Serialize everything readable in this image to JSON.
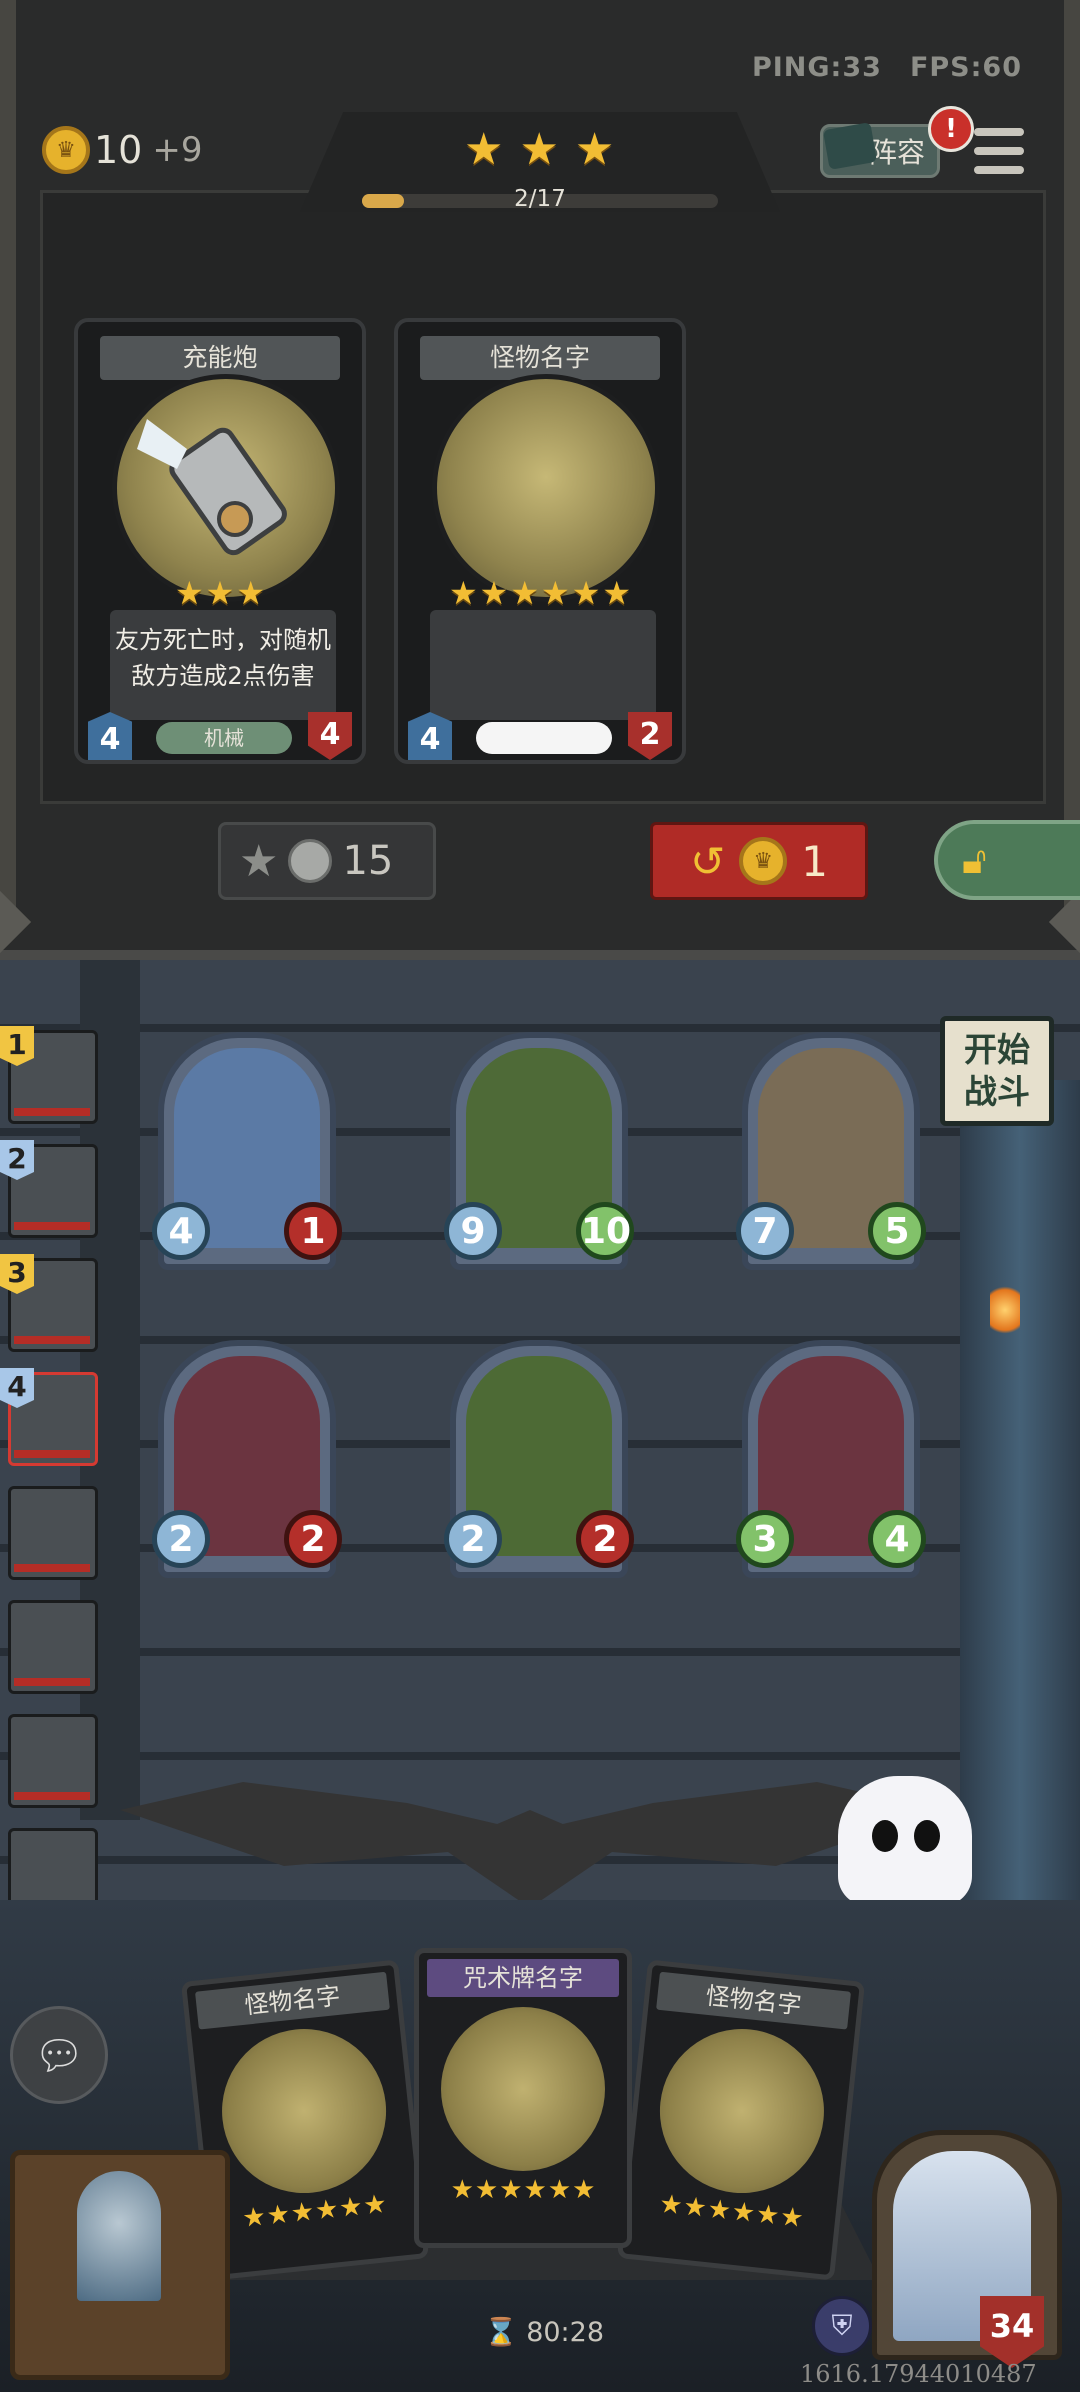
{
  "hud": {
    "ping_label": "PING:33",
    "fps_label": "FPS:60"
  },
  "gold": {
    "value": "10",
    "income": "+9",
    "coin_icon": "crown-coin-icon"
  },
  "tavern": {
    "tier_stars": 3,
    "xp_current": 2,
    "xp_max": 17,
    "xp_text": "2/17"
  },
  "lineup_button": {
    "label": "阵容",
    "alert": "!"
  },
  "shop_cards": [
    {
      "title": "充能炮",
      "stars": 3,
      "description": "友方死亡时，对随机敌方造成2点伤害",
      "tag": "机械",
      "attack": "4",
      "health": "4"
    },
    {
      "title": "怪物名字",
      "stars": 6,
      "description": "",
      "tag": "",
      "attack": "4",
      "health": "2"
    }
  ],
  "upgrade": {
    "cost": "15"
  },
  "refresh": {
    "cost": "1"
  },
  "start_battle": {
    "label_line1": "开始",
    "label_line2": "战斗"
  },
  "team_list": [
    {
      "num": "1",
      "hp_fraction": 0.8
    },
    {
      "num": "2",
      "hp_fraction": 0.8
    },
    {
      "num": "3",
      "hp_fraction": 0.8
    },
    {
      "num": "4",
      "hp_fraction": 0.8,
      "selected": true
    },
    {
      "num": "",
      "hp_fraction": 0.8
    },
    {
      "num": "",
      "hp_fraction": 0.8
    },
    {
      "num": "",
      "hp_fraction": 0.8
    },
    {
      "num": "",
      "hp_fraction": 0.8
    }
  ],
  "board_minions": [
    {
      "attack": "4",
      "health": "1",
      "art_color": "#5b7aa5"
    },
    {
      "attack": "9",
      "health": "10",
      "art_color": "#4e6a37"
    },
    {
      "attack": "7",
      "health": "5",
      "art_color": "#7a6c56"
    },
    {
      "attack": "2",
      "health": "2",
      "art_color": "#6b3440"
    },
    {
      "attack": "2",
      "health": "2",
      "art_color": "#4d6a35"
    },
    {
      "attack": "3",
      "health": "4",
      "art_color": "#6b3440"
    }
  ],
  "hand_cards": [
    {
      "title": "怪物名字",
      "stars": 6,
      "type": "monster"
    },
    {
      "title": "咒术牌名字",
      "stars": 6,
      "type": "spell"
    },
    {
      "title": "怪物名字",
      "stars": 6,
      "type": "monster"
    }
  ],
  "hero": {
    "health": "34"
  },
  "timer": {
    "value": "80:28"
  },
  "debug_text": "1616.17944010487",
  "colors": {
    "gold": "#f2bd34",
    "refresh_red": "#b02b26",
    "lock_green": "#4d7a58",
    "attack_blue": "#3f6f9c",
    "health_red": "#a8302c"
  }
}
